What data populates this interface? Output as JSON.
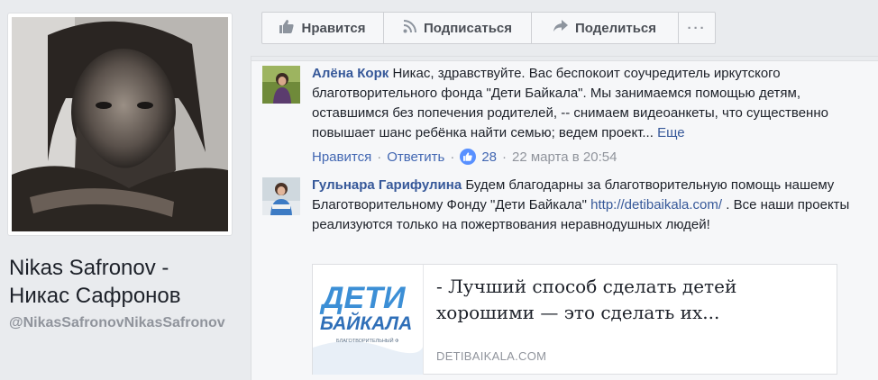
{
  "page": {
    "name": "Nikas Safronov - Никас Сафронов",
    "handle": "@NikasSafronovNikasSafronov"
  },
  "actions": {
    "like": "Нравится",
    "follow": "Подписаться",
    "share": "Поделиться",
    "more": "···"
  },
  "comments": [
    {
      "author": "Алёна Корк",
      "text": "Никас, здравствуйте. Вас беспокоит соучредитель иркутского благотворительного фонда \"Дети Байкала\". Мы занимаемся помощью детям, оставшимся без попечения родителей, -- снимаем видеоанкеты, что существенно повышает шанс ребёнка найти семью; ведем проект...",
      "more": "Еще",
      "like": "Нравится",
      "reply": "Ответить",
      "likes": "28",
      "time": "22 марта в 20:54"
    },
    {
      "author": "Гульнара Гарифулина",
      "text_before": "Будем благодарны за благотворительную помощь нашему Благотворительному Фонду \"Дети Байкала\"",
      "link": "http://detibaikala.com/",
      "text_after": ". Все наши проекты реализуются только на пожертвования неравнодушных людей!"
    }
  ],
  "preview": {
    "logo_top": "ДЕТИ",
    "logo_bottom": "БАЙКАЛА",
    "logo_caption": "БЛАГОТВОРИТЕЛЬНЫЙ Ф",
    "title": "- Лучший способ сделать детей хорошими — это сделать их...",
    "domain": "DETIBAIKALA.COM"
  },
  "colors": {
    "link": "#365899",
    "like_badge": "#5890ff",
    "background": "#e9ebee"
  }
}
